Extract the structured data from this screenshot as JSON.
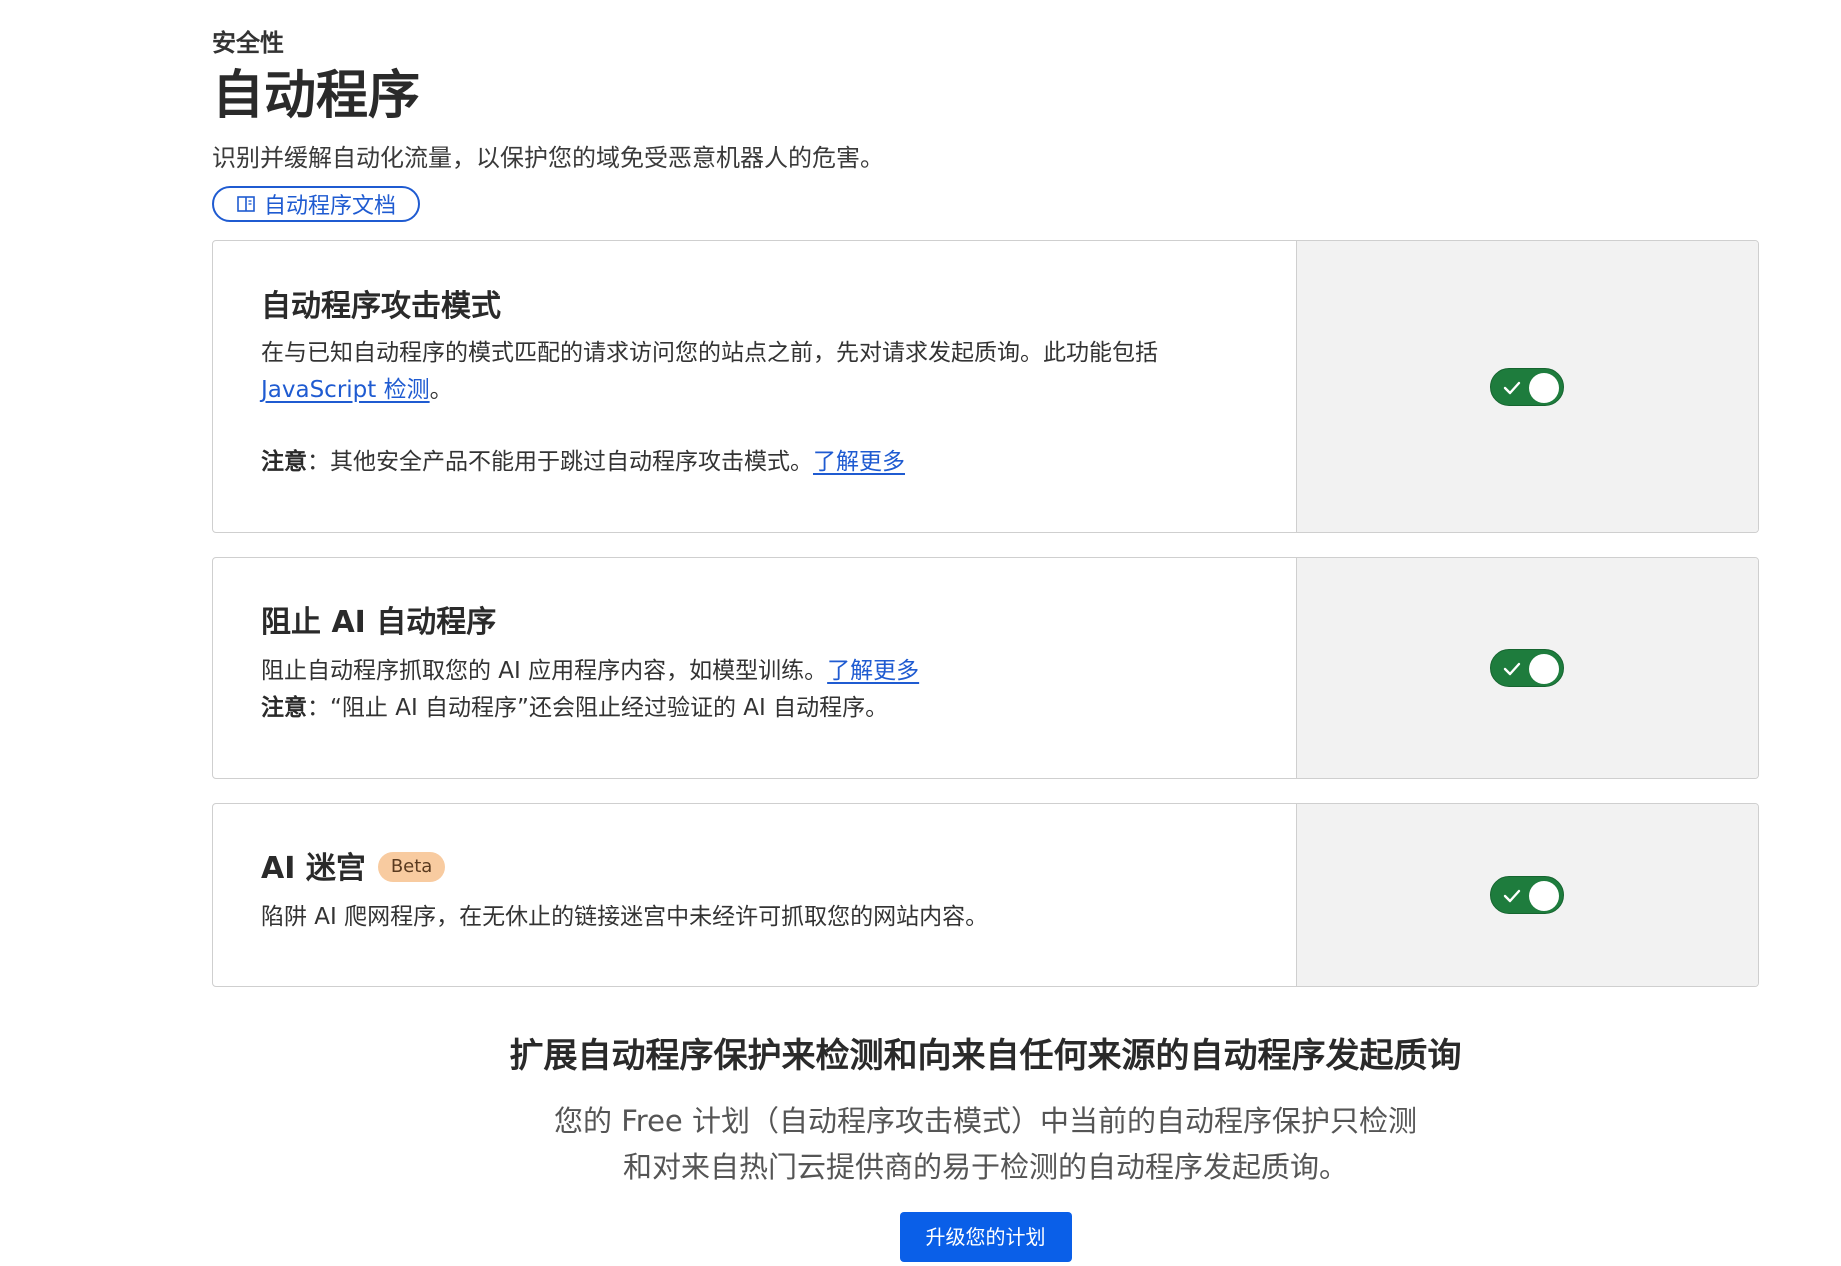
{
  "header": {
    "eyebrow": "安全性",
    "title": "自动程序",
    "subtitle": "识别并缓解自动化流量，以保护您的域免受恶意机器人的危害。",
    "docs_link_label": "自动程序文档",
    "docs_icon": "book-icon"
  },
  "cards": [
    {
      "title": "自动程序攻击模式",
      "desc_before_link": "在与已知自动程序的模式匹配的请求访问您的站点之前，先对请求发起质询。此功能包括",
      "desc_link": "JavaScript 检测",
      "desc_after_link": "。",
      "note_label": "注意",
      "note_text": "：其他安全产品不能用于跳过自动程序攻击模式。",
      "note_link": "了解更多",
      "toggle_on": true
    },
    {
      "title": "阻止 AI 自动程序",
      "desc": "阻止自动程序抓取您的 AI 应用程序内容，如模型训练。",
      "desc_link": "了解更多",
      "note_label": "注意",
      "note_text": "：“阻止 AI 自动程序”还会阻止经过验证的 AI 自动程序。",
      "toggle_on": true
    },
    {
      "title": "AI 迷宫",
      "badge": "Beta",
      "desc": "陷阱 AI 爬网程序，在无休止的链接迷宫中未经许可抓取您的网站内容。",
      "toggle_on": true
    }
  ],
  "promo": {
    "title": "扩展自动程序保护来检测和向来自任何来源的自动程序发起质询",
    "line1": "您的 Free 计划（自动程序攻击模式）中当前的自动程序保护只检测",
    "line2": "和对来自热门云提供商的易于检测的自动程序发起质询。",
    "button_label": "升级您的计划"
  },
  "colors": {
    "accent": "#1f5bd1",
    "toggle_on": "#1e7c3d",
    "button": "#0a5fe8",
    "badge": "#f8cba0"
  }
}
